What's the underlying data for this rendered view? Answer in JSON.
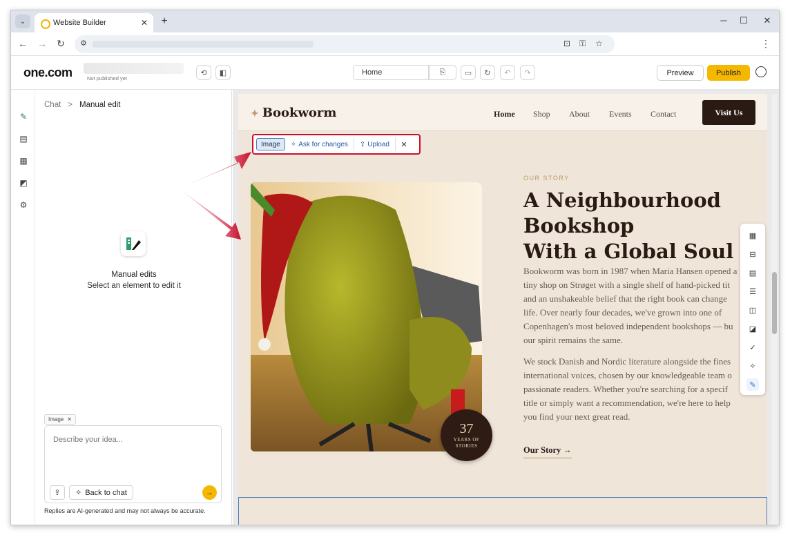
{
  "browser": {
    "tab_title": "Website Builder",
    "new_tab": "+",
    "minimize": "─",
    "maximize": "☐",
    "close": "✕"
  },
  "app": {
    "logo": "one.com",
    "publish_status": "Not published yet",
    "page_selector": "Home",
    "preview_label": "Preview",
    "publish_label": "Publish"
  },
  "panel": {
    "breadcrumb_parent": "Chat",
    "breadcrumb_sep": ">",
    "breadcrumb_current": "Manual edit",
    "empty_title": "Manual edits",
    "empty_subtitle": "Select an element to edit it",
    "chip_label": "Image",
    "composer_placeholder": "Describe your idea...",
    "back_to_chat": "Back to chat",
    "disclaimer": "Replies are AI-generated and may not always be accurate."
  },
  "element_toolbar": {
    "type_label": "Image",
    "ask_label": "Ask for changes",
    "upload_label": "Upload"
  },
  "site": {
    "brand": "Bookworm",
    "nav": [
      "Home",
      "Shop",
      "About",
      "Events",
      "Contact"
    ],
    "cta": "Visit Us",
    "eyebrow": "OUR STORY",
    "headline_1": "A Neighbourhood",
    "headline_2": "Bookshop",
    "headline_3": "With a Global Soul",
    "paragraph_1": [
      "Bookworm was born in 1987 when Maria Hansen opened a",
      "tiny shop on Strøget with a single shelf of hand-picked tit",
      "and an unshakeable belief that the right book can change",
      "life. Over nearly four decades, we've grown into one of",
      "Copenhagen's most beloved independent bookshops — bu",
      "our spirit remains the same."
    ],
    "paragraph_2": [
      "We stock Danish and Nordic literature alongside the fines",
      "international voices, chosen by our knowledgeable team o",
      "passionate readers. Whether you're searching for a specif",
      "title or simply want a recommendation, we're here to help",
      "you find your next great read."
    ],
    "story_link": "Our Story →",
    "badge_number": "37",
    "badge_label_1": "YEARS OF",
    "badge_label_2": "STORIES"
  },
  "colors": {
    "accent_yellow": "#f5b800",
    "highlight_red": "#c8102e",
    "site_dark": "#2a1a14",
    "site_bg": "#efe5d8"
  }
}
